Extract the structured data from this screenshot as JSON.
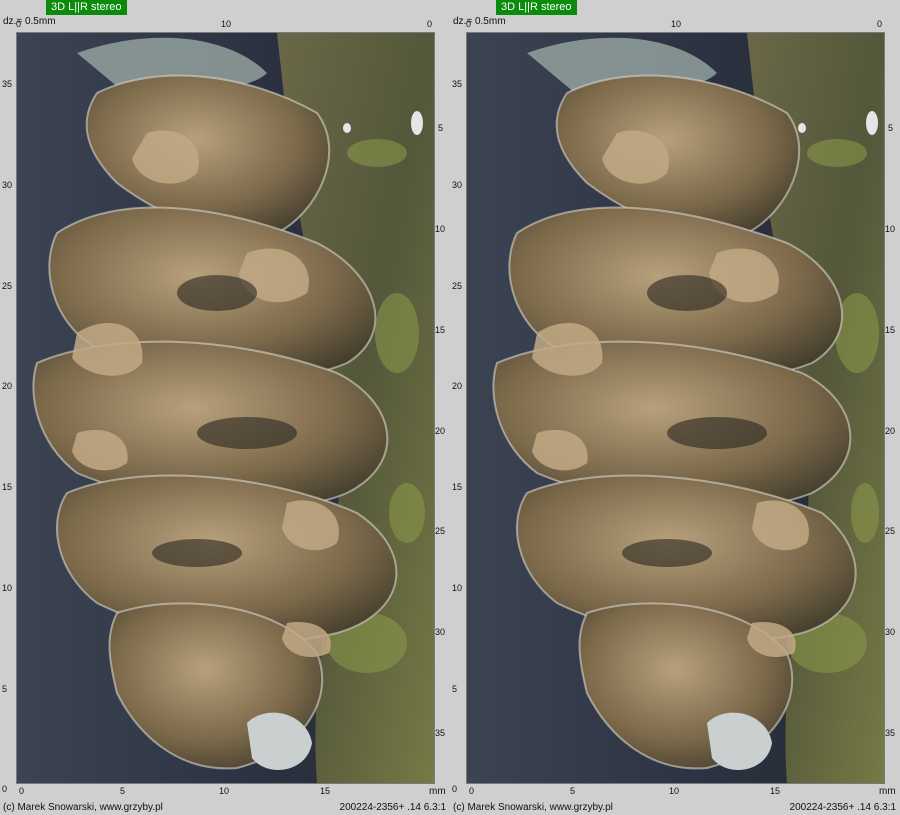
{
  "panels": [
    {
      "badge": "3D L||R stereo",
      "dz": "dz.= 0.5mm",
      "credit": "(c) Marek Snowarski, www.grzyby.pl",
      "caption": "200224-2356+ .14   6.3:1",
      "unit": "mm"
    },
    {
      "badge": "3D L||R stereo",
      "dz": "dz.= 0.5mm",
      "credit": "(c) Marek Snowarski, www.grzyby.pl",
      "caption": "200224-2356+ .14   6.3:1",
      "unit": "mm"
    }
  ],
  "rulers": {
    "top_labels": [
      "0",
      "10",
      "0"
    ],
    "left_labels": [
      "35",
      "30",
      "25",
      "20",
      "15",
      "10",
      "5",
      "0"
    ],
    "right_labels": [
      "5",
      "10",
      "15",
      "20",
      "25",
      "30",
      "35"
    ],
    "bottom_labels": [
      "0",
      "5",
      "10",
      "15"
    ]
  },
  "colors": {
    "background": "#2e3544",
    "bark": "#5b5b3a",
    "lichen_brown": "#8a7552",
    "lichen_light": "#b49a78",
    "lichen_silver": "#c8ccc6",
    "badge": "#0b8a0b"
  }
}
